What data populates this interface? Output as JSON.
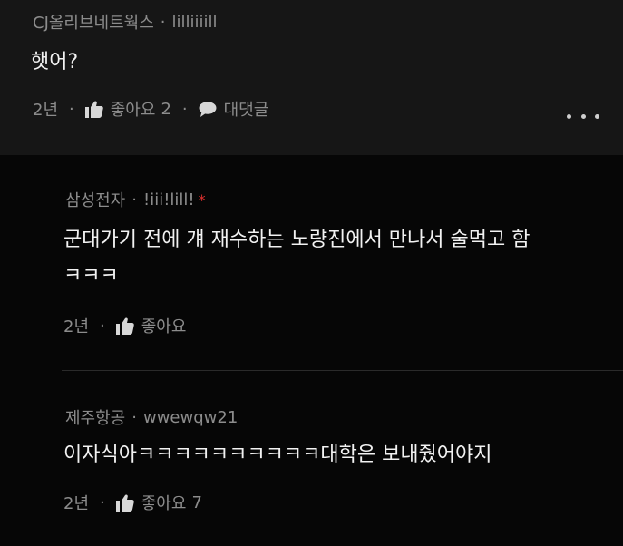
{
  "comment": {
    "author": "CJ올리브네트웍스",
    "separator": "·",
    "nickname": "lilliiiill",
    "text": "햇어?",
    "time": "2년",
    "like_label": "좋아요",
    "like_count": "2",
    "reply_label": "대댓글"
  },
  "replies": [
    {
      "author": "삼성전자",
      "nickname": "!iii!lill!",
      "badge": "*",
      "text_line1": "군대가기 전에 걔 재수하는 노량진에서 만나서 술먹고 함",
      "text_line2": "ㅋㅋㅋ",
      "time": "2년",
      "like_label": "좋아요",
      "like_count": ""
    },
    {
      "author": "제주항공",
      "nickname": "wwewqw21",
      "text_line1": "이자식아ㅋㅋㅋㅋㅋㅋㅋㅋㅋㅋ대학은 보내줬어야지",
      "time": "2년",
      "like_label": "좋아요",
      "like_count": "7"
    }
  ],
  "colors": {
    "background": "#000000",
    "main_comment_bg": "#161616",
    "text": "#f2f2f2",
    "muted": "#8c8c8c",
    "badge": "#e0302e"
  },
  "icons": {
    "like": "thumbs-up-icon",
    "reply": "speech-bubble-icon",
    "more": "more-dots-icon"
  }
}
